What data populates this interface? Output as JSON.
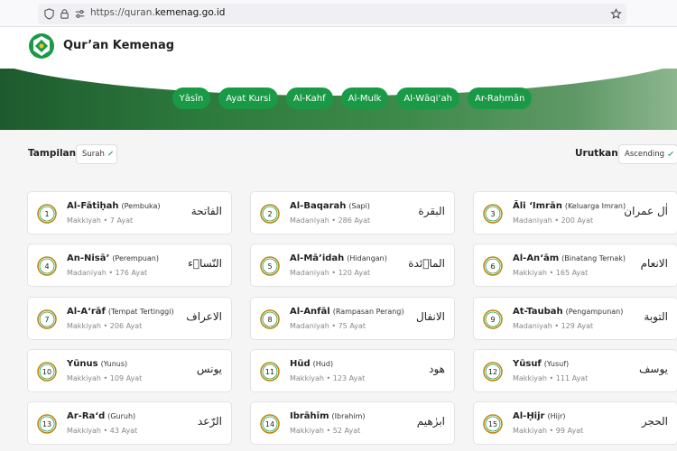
{
  "browser": {
    "url_prefix": "https://quran.",
    "url_domain": "kemenag.go.id"
  },
  "header": {
    "brand": "Qur’an Kemenag"
  },
  "hero": {
    "chips": [
      "Yāsīn",
      "Ayat Kursi",
      "Al-Kahf",
      "Al-Mulk",
      "Al-Wāqi‘ah",
      "Ar-Raḥmān"
    ]
  },
  "toolbar": {
    "tampilan_label": "Tampilan",
    "tampilan_value": "Surah",
    "urutkan_label": "Urutkan",
    "urutkan_value": "Ascending"
  },
  "colors": {
    "accent": "#1a9a46",
    "badge_ring": "#b8860b"
  },
  "surahs": [
    {
      "num": "1",
      "name": "Al-Fātiḥah",
      "trans": "(Pembuka)",
      "meta": "Makkiyah • 7 Ayat",
      "arabic": "الفاتحة"
    },
    {
      "num": "2",
      "name": "Al-Baqarah",
      "trans": "(Sapi)",
      "meta": "Madaniyah • 286 Ayat",
      "arabic": "البقرة"
    },
    {
      "num": "3",
      "name": "Āli ‘Imrān",
      "trans": "(Keluarga Imran)",
      "meta": "Madaniyah • 200 Ayat",
      "arabic": "اٰل عمران"
    },
    {
      "num": "4",
      "name": "An-Nisā’",
      "trans": "(Perempuan)",
      "meta": "Madaniyah • 176 Ayat",
      "arabic": "النّساۤء"
    },
    {
      "num": "5",
      "name": "Al-Mā’idah",
      "trans": "(Hidangan)",
      "meta": "Madaniyah • 120 Ayat",
      "arabic": "الماۤئدة"
    },
    {
      "num": "6",
      "name": "Al-An‘ām",
      "trans": "(Binatang Ternak)",
      "meta": "Makkiyah • 165 Ayat",
      "arabic": "الانعام"
    },
    {
      "num": "7",
      "name": "Al-A‘rāf",
      "trans": "(Tempat Tertinggi)",
      "meta": "Makkiyah • 206 Ayat",
      "arabic": "الاعراف"
    },
    {
      "num": "8",
      "name": "Al-Anfāl",
      "trans": "(Rampasan Perang)",
      "meta": "Madaniyah • 75 Ayat",
      "arabic": "الانفال"
    },
    {
      "num": "9",
      "name": "At-Taubah",
      "trans": "(Pengampunan)",
      "meta": "Madaniyah • 129 Ayat",
      "arabic": "التوبة"
    },
    {
      "num": "10",
      "name": "Yūnus",
      "trans": "(Yunus)",
      "meta": "Makkiyah • 109 Ayat",
      "arabic": "يونس"
    },
    {
      "num": "11",
      "name": "Hūd",
      "trans": "(Hud)",
      "meta": "Makkiyah • 123 Ayat",
      "arabic": "هود"
    },
    {
      "num": "12",
      "name": "Yūsuf",
      "trans": "(Yusuf)",
      "meta": "Makkiyah • 111 Ayat",
      "arabic": "يوسف"
    },
    {
      "num": "13",
      "name": "Ar-Ra‘d",
      "trans": "(Guruh)",
      "meta": "Makkiyah • 43 Ayat",
      "arabic": "الرّعد"
    },
    {
      "num": "14",
      "name": "Ibrāhīm",
      "trans": "(Ibrahim)",
      "meta": "Makkiyah • 52 Ayat",
      "arabic": "ابرٰهيم"
    },
    {
      "num": "15",
      "name": "Al-Ḥijr",
      "trans": "(Hijr)",
      "meta": "Makkiyah • 99 Ayat",
      "arabic": "الحجر"
    }
  ]
}
